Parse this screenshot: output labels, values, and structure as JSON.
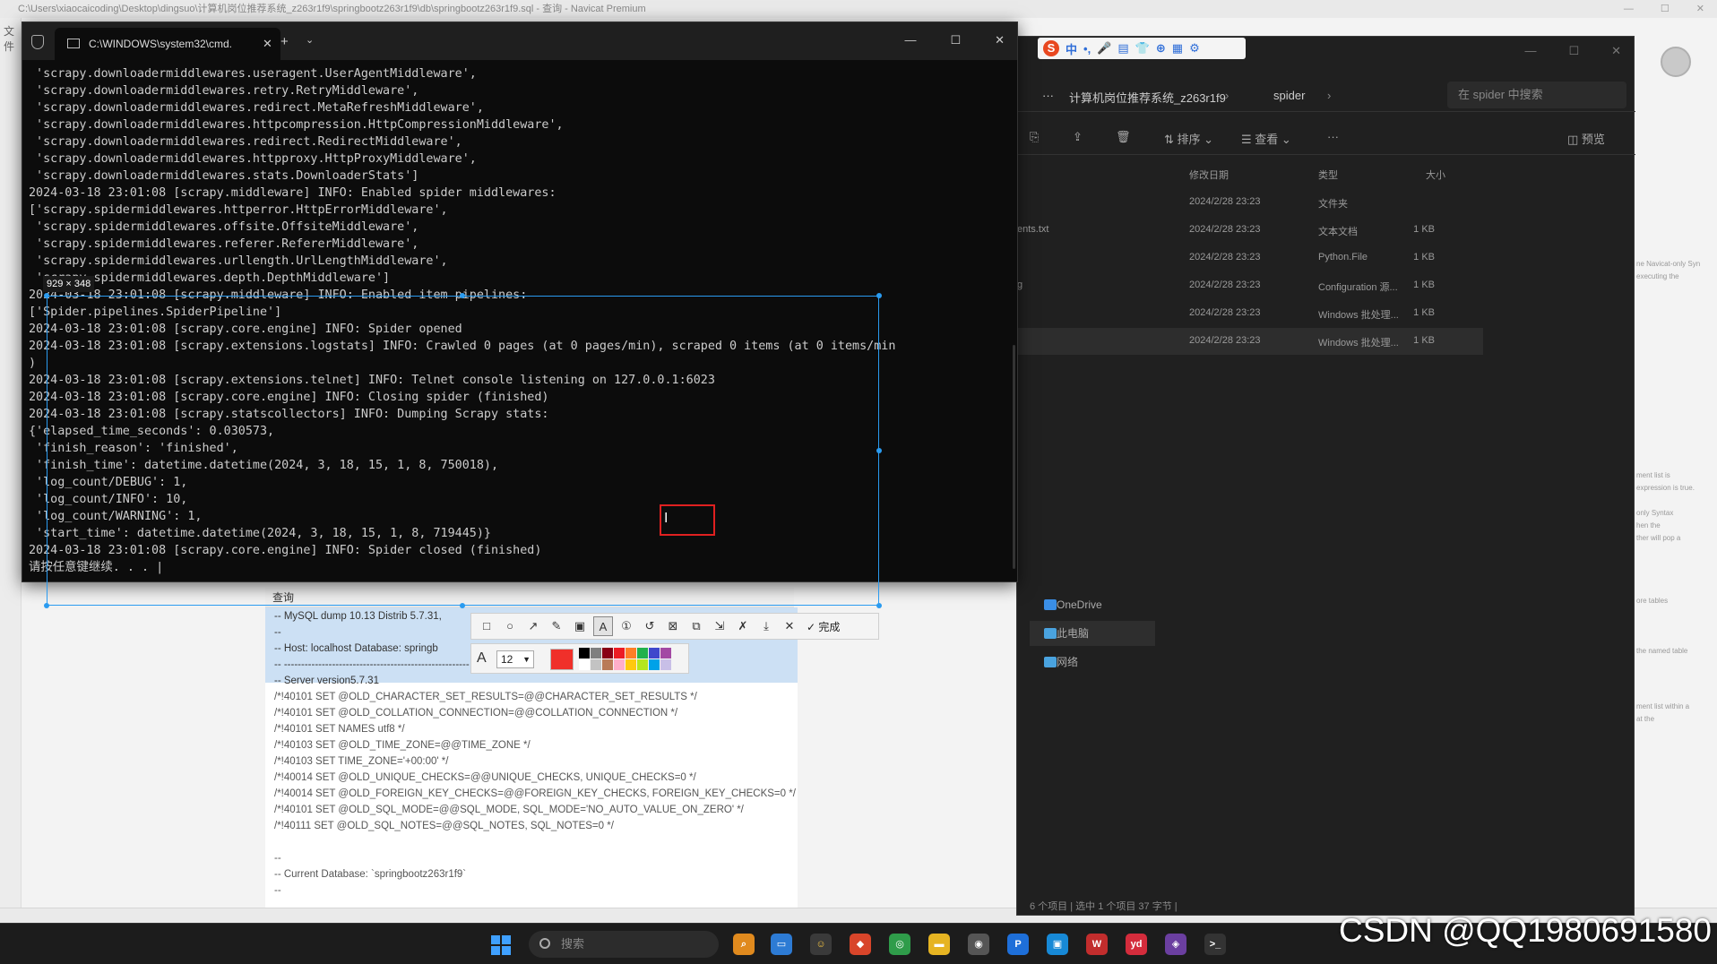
{
  "navicat": {
    "title": "C:\\Users\\xiaocaicoding\\Desktop\\dingsuo\\计算机岗位推荐系统_z263r1f9\\springbootz263r1f9\\db\\springbootz263r1f9.sql - 查询 - Navicat Premium",
    "left_label": "文件",
    "query_tab": "查询",
    "sql_lines": [
      "-- MySQL dump 10.13  Distrib 5.7.31,",
      "--",
      "-- Host: localhost    Database: springb",
      "-- ------------------------------------------------------",
      "-- Server version5.7.31",
      "/*!40101 SET @OLD_CHARACTER_SET_RESULTS=@@CHARACTER_SET_RESULTS */",
      "/*!40101 SET @OLD_COLLATION_CONNECTION=@@COLLATION_CONNECTION */",
      "/*!40101 SET NAMES utf8 */",
      "/*!40103 SET @OLD_TIME_ZONE=@@TIME_ZONE */",
      "/*!40103 SET TIME_ZONE='+00:00' */",
      "/*!40014 SET @OLD_UNIQUE_CHECKS=@@UNIQUE_CHECKS, UNIQUE_CHECKS=0 */",
      "/*!40014 SET @OLD_FOREIGN_KEY_CHECKS=@@FOREIGN_KEY_CHECKS, FOREIGN_KEY_CHECKS=0 */",
      "/*!40101 SET @OLD_SQL_MODE=@@SQL_MODE, SQL_MODE='NO_AUTO_VALUE_ON_ZERO' */",
      "/*!40111 SET @OLD_SQL_NOTES=@@SQL_NOTES, SQL_NOTES=0 */",
      "",
      "--",
      "-- Current Database: `springbootz263r1f9`",
      "--"
    ],
    "info_panel": [
      "ne  Navicat-only Syn",
      "executing the",
      "ment list is",
      "expression is true.",
      "only Syntax",
      "hen the",
      "ther will pop a",
      "ore tables",
      "the named table",
      "ment list within a",
      "at the"
    ]
  },
  "explorer": {
    "breadcrumbs": [
      "···",
      "计算机岗位推荐系统_z263r1f9",
      "spider"
    ],
    "search_placeholder": "在 spider 中搜索",
    "toolbar": {
      "sort": "排序",
      "view": "查看",
      "more": "···",
      "preview": "预览"
    },
    "columns": {
      "date": "修改日期",
      "type": "类型",
      "size": "大小"
    },
    "rows": [
      {
        "name": "",
        "date": "2024/2/28 23:23",
        "type": "文件夹",
        "size": ""
      },
      {
        "name": "ents.txt",
        "date": "2024/2/28 23:23",
        "type": "文本文档",
        "size": "1 KB"
      },
      {
        "name": "",
        "date": "2024/2/28 23:23",
        "type": "Python.File",
        "size": "1 KB"
      },
      {
        "name": "g",
        "date": "2024/2/28 23:23",
        "type": "Configuration 源...",
        "size": "1 KB"
      },
      {
        "name": "",
        "date": "2024/2/28 23:23",
        "type": "Windows 批处理...",
        "size": "1 KB"
      },
      {
        "name": "",
        "date": "2024/2/28 23:23",
        "type": "Windows 批处理...",
        "size": "1 KB"
      }
    ],
    "nav_items": [
      "OneDrive",
      "此电脑",
      "网络"
    ],
    "status": "6 个项目  |  选中 1 个项目  37 字节  |"
  },
  "ime": {
    "logo": "S",
    "glyphs": [
      "中",
      "•,",
      "🎤",
      "▤",
      "👕",
      "⊕",
      "▦",
      "⚙"
    ]
  },
  "terminal": {
    "tab_title": "C:\\WINDOWS\\system32\\cmd.",
    "lines": [
      " 'scrapy.downloadermiddlewares.useragent.UserAgentMiddleware',",
      " 'scrapy.downloadermiddlewares.retry.RetryMiddleware',",
      " 'scrapy.downloadermiddlewares.redirect.MetaRefreshMiddleware',",
      " 'scrapy.downloadermiddlewares.httpcompression.HttpCompressionMiddleware',",
      " 'scrapy.downloadermiddlewares.redirect.RedirectMiddleware',",
      " 'scrapy.downloadermiddlewares.httpproxy.HttpProxyMiddleware',",
      " 'scrapy.downloadermiddlewares.stats.DownloaderStats']",
      "2024-03-18 23:01:08 [scrapy.middleware] INFO: Enabled spider middlewares:",
      "['scrapy.spidermiddlewares.httperror.HttpErrorMiddleware',",
      " 'scrapy.spidermiddlewares.offsite.OffsiteMiddleware',",
      " 'scrapy.spidermiddlewares.referer.RefererMiddleware',",
      " 'scrapy.spidermiddlewares.urllength.UrlLengthMiddleware',",
      " 'scrapy.spidermiddlewares.depth.DepthMiddleware']",
      "2024-03-18 23:01:08 [scrapy.middleware] INFO: Enabled item pipelines:",
      "['Spider.pipelines.SpiderPipeline']",
      "2024-03-18 23:01:08 [scrapy.core.engine] INFO: Spider opened",
      "2024-03-18 23:01:08 [scrapy.extensions.logstats] INFO: Crawled 0 pages (at 0 pages/min), scraped 0 items (at 0 items/min",
      ")",
      "2024-03-18 23:01:08 [scrapy.extensions.telnet] INFO: Telnet console listening on 127.0.0.1:6023",
      "2024-03-18 23:01:08 [scrapy.core.engine] INFO: Closing spider (finished)",
      "2024-03-18 23:01:08 [scrapy.statscollectors] INFO: Dumping Scrapy stats:",
      "{'elapsed_time_seconds': 0.030573,",
      " 'finish_reason': 'finished',",
      " 'finish_time': datetime.datetime(2024, 3, 18, 15, 1, 8, 750018),",
      " 'log_count/DEBUG': 1,",
      " 'log_count/INFO': 10,",
      " 'log_count/WARNING': 1,",
      " 'start_time': datetime.datetime(2024, 3, 18, 15, 1, 8, 719445)}",
      "2024-03-18 23:01:08 [scrapy.core.engine] INFO: Spider closed (finished)",
      "请按任意键继续. . . |"
    ]
  },
  "snip": {
    "size_label": "929 × 348",
    "tools": [
      "□",
      "○",
      "↗",
      "✎",
      "▣",
      "A",
      "①",
      "↺",
      "⊠",
      "⧉",
      "⇲",
      "✗",
      "⤓",
      "✕"
    ],
    "done_label": "✓ 完成",
    "font_size": "12",
    "current_color": "#f0302a",
    "palette": [
      "#000000",
      "#7f7f7f",
      "#880015",
      "#ed1c24",
      "#ff7f27",
      "#22b14c",
      "#3f48cc",
      "#a349a4",
      "#ffffff",
      "#c3c3c3",
      "#b97a57",
      "#ffaec9",
      "#ffc90e",
      "#b5e61d",
      "#00a2e8",
      "#c8bfe7"
    ]
  },
  "taskbar": {
    "search_placeholder": "搜索",
    "watermark": "CSDN @QQ1980691580"
  }
}
